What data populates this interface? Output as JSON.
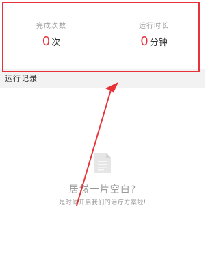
{
  "stats": {
    "completed": {
      "label": "完成次数",
      "value": "0",
      "unit": "次"
    },
    "duration": {
      "label": "运行时长",
      "value": "0",
      "unit": "分钟"
    }
  },
  "section": {
    "title": "运行记录"
  },
  "empty_state": {
    "icon": "document-icon",
    "title": "居然一片空白?",
    "subtitle": "是时候开启我们的治疗方案啦!"
  },
  "colors": {
    "accent": "#e8323a",
    "annotation": "#e8323a",
    "muted": "#9a9a9a",
    "section_bg": "#f2f2f2"
  }
}
